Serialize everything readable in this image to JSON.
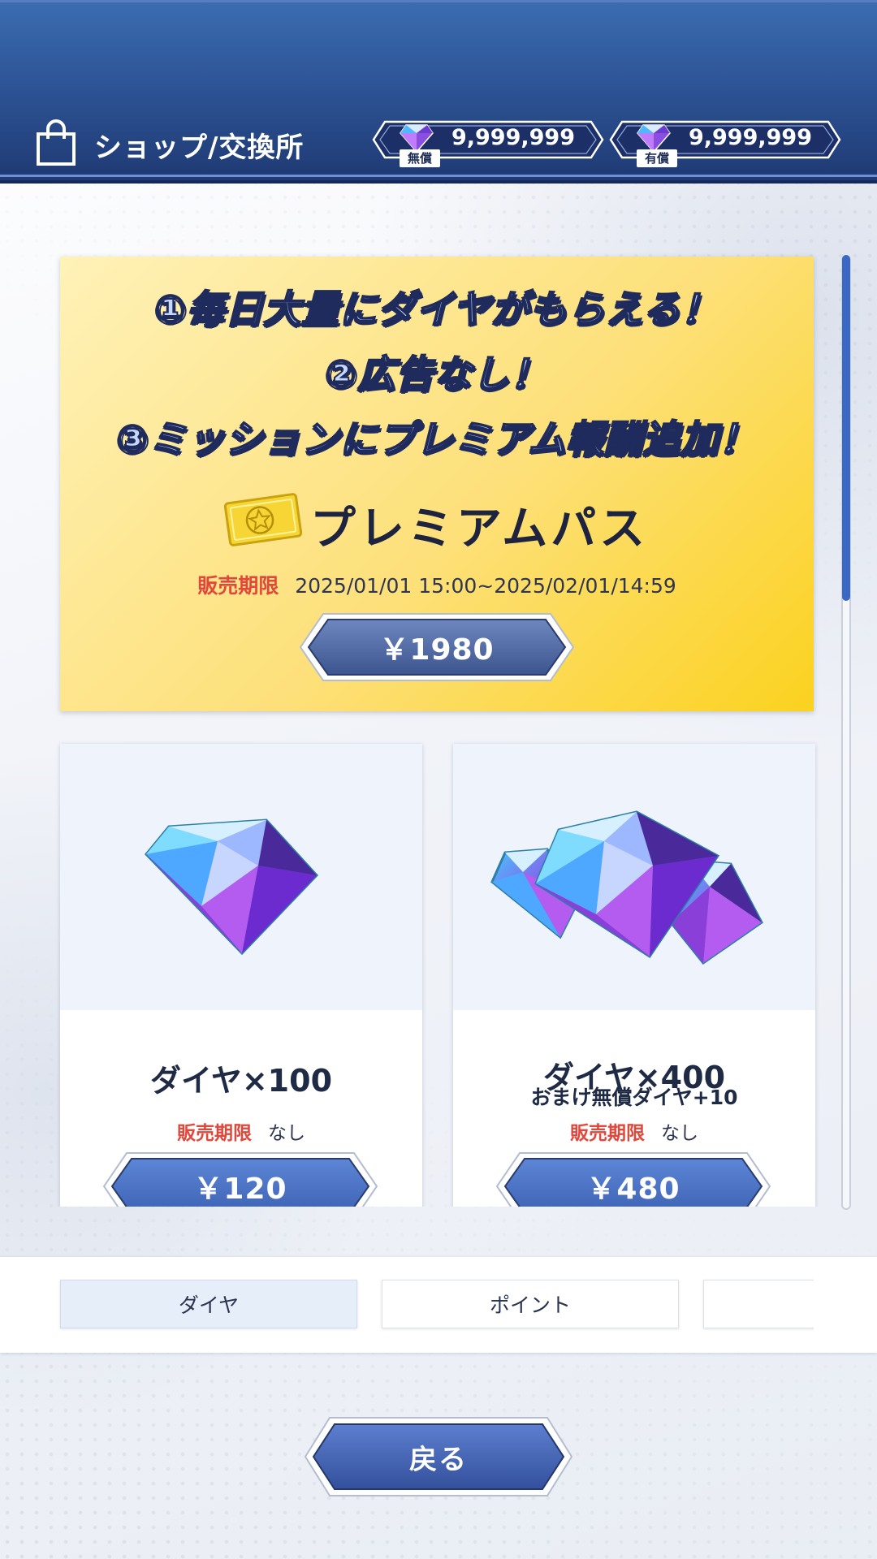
{
  "header": {
    "title": "ショップ/交換所",
    "currencies": [
      {
        "label": "無償",
        "value": "9,999,999",
        "icon": "diamond-icon"
      },
      {
        "label": "有償",
        "value": "9,999,999",
        "icon": "diamond-icon"
      }
    ]
  },
  "premium": {
    "benefits": [
      "①毎日大量にダイヤがもらえる！",
      "②広告なし！",
      "③ミッションにプレミアム報酬追加！"
    ],
    "name": "プレミアムパス",
    "icon": "ticket-icon",
    "sale_label": "販売期限",
    "sale_period": "2025/01/01  15:00~2025/02/01/14:59",
    "price": "￥1980"
  },
  "products": [
    {
      "name": "ダイヤ×100",
      "bonus": "",
      "sale_label": "販売期限",
      "sale_period": "なし",
      "price": "￥120",
      "icon": "diamond-single-icon"
    },
    {
      "name": "ダイヤ×400",
      "bonus": "おまけ無償ダイヤ+10",
      "sale_label": "販売期限",
      "sale_period": "なし",
      "price": "￥480",
      "icon": "diamond-cluster-icon"
    }
  ],
  "tabs": [
    {
      "label": "ダイヤ",
      "active": true
    },
    {
      "label": "ポイント",
      "active": false
    },
    {
      "label": "",
      "active": false
    }
  ],
  "back_button": "戻る",
  "colors": {
    "header": "#2e5597",
    "button": "#4a6fc2",
    "sale_label": "#e2473c",
    "premium_gold": "#fbd21f",
    "scroll_thumb": "#3a68c4"
  }
}
